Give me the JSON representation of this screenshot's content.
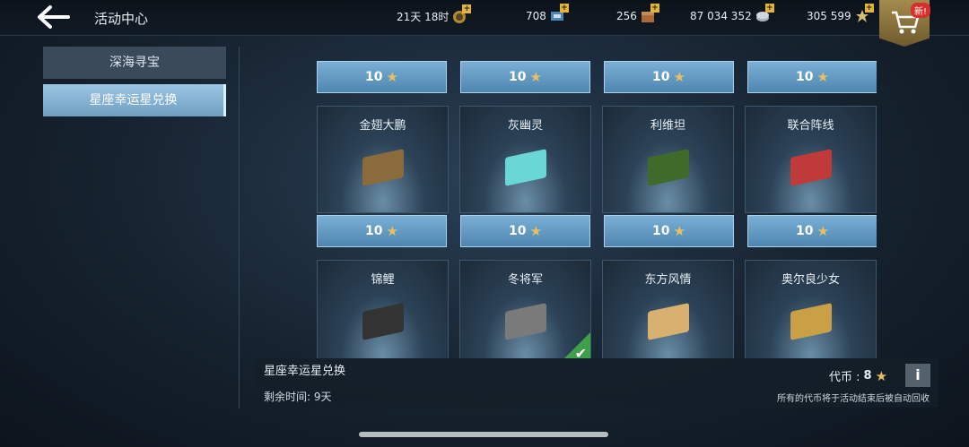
{
  "header": {
    "title": "活动中心",
    "resources": [
      {
        "value": "21天 18时",
        "icon": "season-icon"
      },
      {
        "value": "708",
        "icon": "ticket-icon"
      },
      {
        "value": "256",
        "icon": "chest-icon"
      },
      {
        "value": "87 034 352",
        "icon": "silver-icon"
      },
      {
        "value": "305 599",
        "icon": "free-xp-icon"
      }
    ],
    "shop_badge": "新!"
  },
  "sidebar": {
    "items": [
      {
        "label": "深海寻宝"
      },
      {
        "label": "星座幸运星兑换"
      }
    ]
  },
  "grid": {
    "top_prices": [
      "10",
      "10",
      "10",
      "10"
    ],
    "rows": [
      {
        "items": [
          {
            "name": "金翅大鹏",
            "color": "#8b6a3c"
          },
          {
            "name": "灰幽灵",
            "color": "#6ad6d6"
          },
          {
            "name": "利维坦",
            "color": "#3f6b2a"
          },
          {
            "name": "联合阵线",
            "color": "#c03a3a"
          }
        ],
        "prices": [
          "10",
          "10",
          "10",
          "10"
        ]
      },
      {
        "items": [
          {
            "name": "锦鲤",
            "color": "#333333"
          },
          {
            "name": "冬将军",
            "color": "#7a7a7a",
            "owned": true
          },
          {
            "name": "东方风情",
            "color": "#d8b070"
          },
          {
            "name": "奥尔良少女",
            "color": "#c9a046"
          }
        ]
      }
    ]
  },
  "info": {
    "title": "星座幸运星兑换",
    "remaining": "剩余时间: 9天",
    "token_label": "代币 :",
    "token_value": "8",
    "info_button": "i",
    "notice": "所有的代币将于活动结束后被自动回收"
  }
}
